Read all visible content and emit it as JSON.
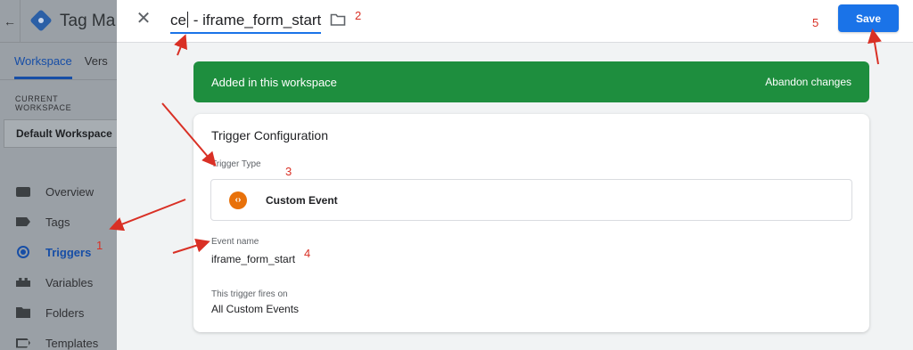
{
  "sidebar": {
    "back_glyph": "←",
    "app_title": "Tag Ma",
    "tabs": [
      {
        "label": "Workspace"
      },
      {
        "label": "Vers"
      }
    ],
    "current_workspace_label": "CURRENT WORKSPACE",
    "workspace_name": "Default Workspace",
    "nav": [
      {
        "label": "Overview",
        "icon": "overview-icon"
      },
      {
        "label": "Tags",
        "icon": "tag-icon"
      },
      {
        "label": "Triggers",
        "icon": "trigger-icon",
        "active": true
      },
      {
        "label": "Variables",
        "icon": "variables-icon"
      },
      {
        "label": "Folders",
        "icon": "folder-icon"
      },
      {
        "label": "Templates",
        "icon": "templates-icon"
      }
    ]
  },
  "editor": {
    "close_glyph": "✕",
    "name_prefix": "ce",
    "name_suffix": " - iframe_form_start",
    "save_label": "Save"
  },
  "banner": {
    "text": "Added in this workspace",
    "action": "Abandon changes",
    "color": "#1e8e3e"
  },
  "config": {
    "title": "Trigger Configuration",
    "trigger_type_label": "Trigger Type",
    "trigger_type_value": "Custom Event",
    "trigger_type_icon_glyph": "‹›",
    "event_name_label": "Event name",
    "event_name_value": "iframe_form_start",
    "fires_on_label": "This trigger fires on",
    "fires_on_value": "All Custom Events"
  },
  "annotations": {
    "labels": [
      "1",
      "2",
      "3",
      "4",
      "5"
    ],
    "color": "#d93025"
  },
  "colors": {
    "accent": "#1a73e8",
    "active_nav": "#174ea6",
    "custom_event_icon": "#e8710a"
  }
}
